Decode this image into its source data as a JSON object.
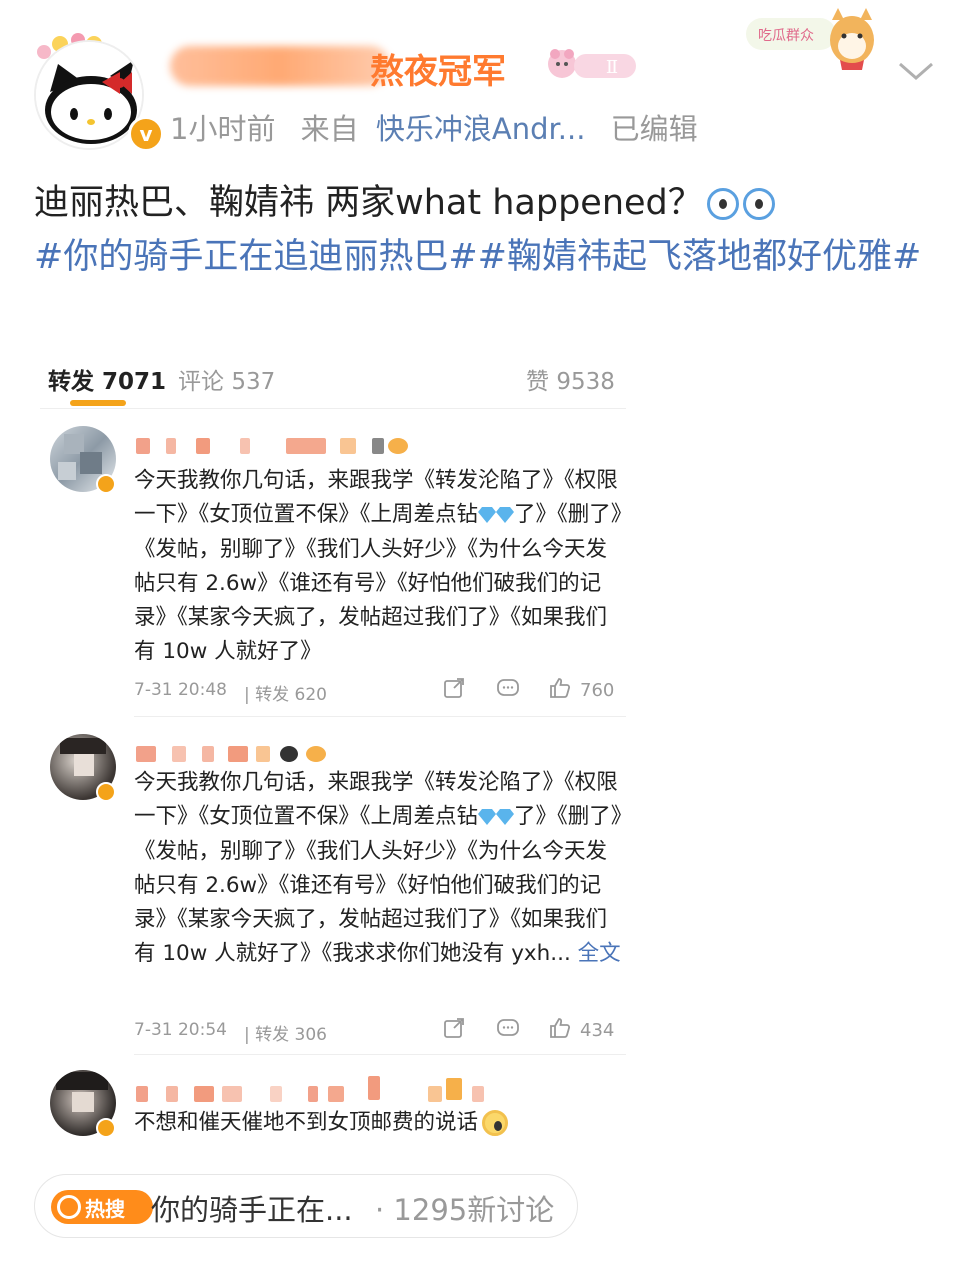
{
  "header": {
    "username_suffix": "熬夜冠军",
    "medal_label": "Ⅱ",
    "meta_time": "1小时前",
    "meta_from": "来自",
    "meta_source": "快乐冲浪Andr...",
    "meta_edited": "已编辑",
    "sticker_text": "吃瓜群众"
  },
  "post": {
    "line1": "迪丽热巴、鞠婧祎 两家what happened？",
    "topic1": "#你的骑手正在追迪丽热巴#",
    "topic2": "#鞠婧祎起飞落地都好优雅#"
  },
  "tabs": {
    "repost_label": "转发",
    "repost_count": "7071",
    "comment_label": "评论",
    "comment_count": "537",
    "like_label": "赞",
    "like_count": "9538"
  },
  "comments": [
    {
      "text_a": "今天我教你几句话，来跟我学《转发沦陷了》《权限一下》《女顶位置不保》《上周差点钻",
      "text_b": "了》《删了》《发帖，别聊了》《我们人头好少》《为什么今天发帖只有 2.6w》《谁还有号》《好怕他们破我们的记录》《某家今天疯了，发帖超过我们了》《如果我们有 10w 人就好了》",
      "more": "",
      "date": "7-31 20:48",
      "reposts": "| 转发 620",
      "likes": "760"
    },
    {
      "text_a": "今天我教你几句话，来跟我学《转发沦陷了》《权限一下》《女顶位置不保》《上周差点钻",
      "text_b": "了》《删了》《发帖，别聊了》《我们人头好少》《为什么今天发帖只有 2.6w》《谁还有号》《好怕他们破我们的记录》《某家今天疯了，发帖超过我们了》《如果我们有 10w 人就好了》《我求求你们她没有 yxh... ",
      "more": "全文",
      "date": "7-31 20:54",
      "reposts": "| 转发 306",
      "likes": "434"
    },
    {
      "text_a": "不想和催天催地不到女顶邮费的说话",
      "text_b": "",
      "more": ""
    }
  ],
  "hotsearch": {
    "badge": "热搜",
    "text": "你的骑手正在...",
    "count": "· 1295新讨论"
  },
  "colors": {
    "accent_orange": "#f4a31a",
    "topic_blue": "#4a74b8",
    "username_orange": "#ff7a2f",
    "hot_orange": "#ff8c1a"
  }
}
